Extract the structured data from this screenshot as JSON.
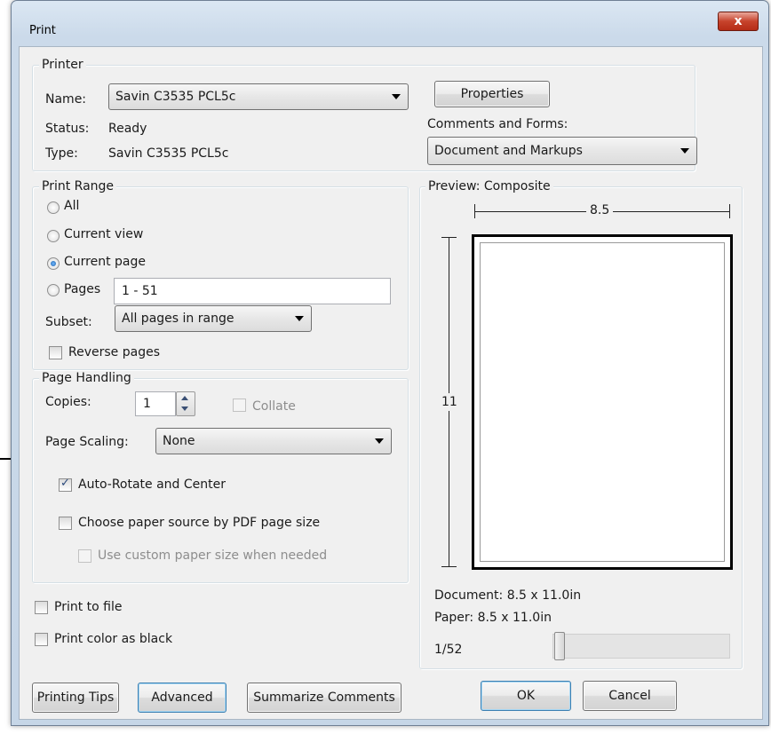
{
  "window": {
    "title": "Print",
    "close_glyph": "x"
  },
  "printer": {
    "legend": "Printer",
    "name_label": "Name:",
    "name_value": "Savin C3535 PCL5c",
    "status_label": "Status:",
    "status_value": "Ready",
    "type_label": "Type:",
    "type_value": "Savin C3535 PCL5c",
    "properties_button": "Properties",
    "comments_label": "Comments and Forms:",
    "comments_value": "Document and Markups"
  },
  "print_range": {
    "legend": "Print Range",
    "all": "All",
    "current_view": "Current view",
    "current_page": "Current page",
    "pages": "Pages",
    "pages_value": "1 - 51",
    "selected": "current_page",
    "subset_label": "Subset:",
    "subset_value": "All pages in range",
    "reverse_pages": "Reverse pages",
    "reverse_checked": false
  },
  "page_handling": {
    "legend": "Page Handling",
    "copies_label": "Copies:",
    "copies_value": "1",
    "collate": "Collate",
    "page_scaling_label": "Page Scaling:",
    "page_scaling_value": "None",
    "auto_rotate": "Auto-Rotate and Center",
    "auto_rotate_checked": true,
    "paper_source": "Choose paper source by PDF page size",
    "paper_source_checked": false,
    "custom_paper": "Use custom paper size when needed",
    "custom_paper_checked": false
  },
  "options": {
    "print_to_file": "Print to file",
    "print_color_as_black": "Print color as black"
  },
  "preview": {
    "title": "Preview: Composite",
    "width_label": "8.5",
    "height_label": "11",
    "document_size": "Document: 8.5 x 11.0in",
    "paper_size": "Paper: 8.5 x 11.0in",
    "page_indicator": "1/52",
    "page_position": 1,
    "page_total": 52
  },
  "buttons": {
    "printing_tips": "Printing Tips",
    "advanced": "Advanced",
    "summarize_comments": "Summarize Comments",
    "ok": "OK",
    "cancel": "Cancel"
  }
}
